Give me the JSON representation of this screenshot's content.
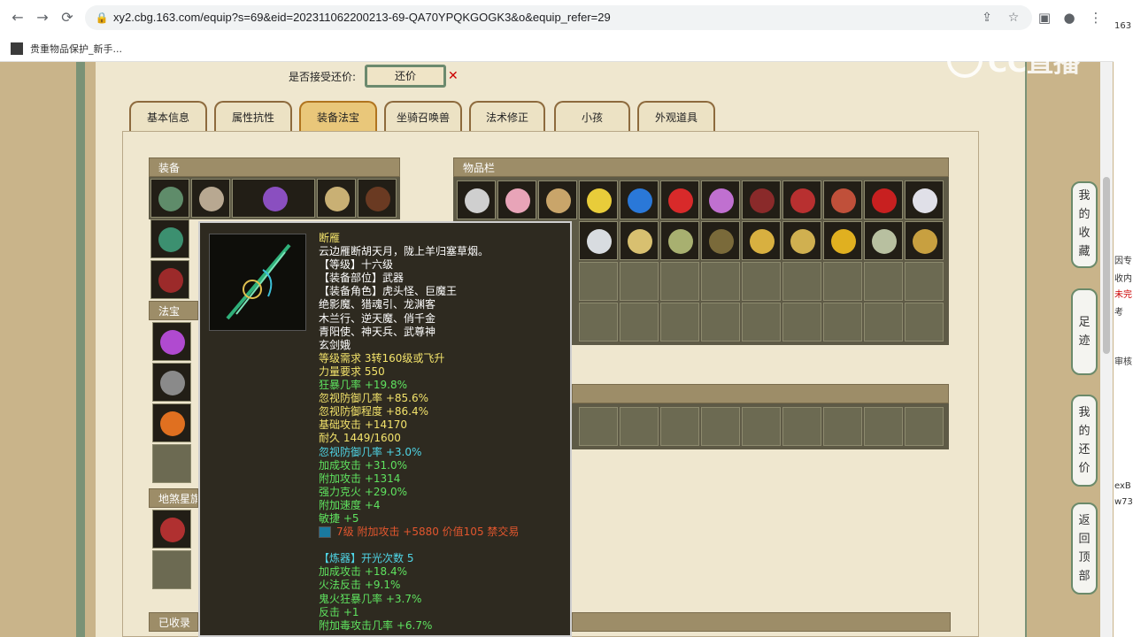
{
  "browser": {
    "url": "xy2.cbg.163.com/equip?s=69&eid=202311062200213-69-QA70YPQKGOGK3&o&equip_refer=29",
    "bookmark": "贵重物品保护_新手..."
  },
  "offer": {
    "label": "是否接受还价:",
    "button": "还价"
  },
  "tabs": [
    "基本信息",
    "属性抗性",
    "装备法宝",
    "坐骑召唤兽",
    "法术修正",
    "小孩",
    "外观道具"
  ],
  "active_tab": "装备法宝",
  "panels": {
    "equip": "装备",
    "items": "物品栏",
    "treasure": "法宝",
    "star": "地煞星旗",
    "collected": "已收录"
  },
  "tooltip": {
    "lines": [
      {
        "text": "断雁",
        "color": "#f3e36b"
      },
      {
        "text": "云边雁断胡天月，陇上羊归塞草烟。",
        "color": "#ffffff"
      },
      {
        "text": "【等级】十六级",
        "color": "#ffffff"
      },
      {
        "text": "【装备部位】武器",
        "color": "#ffffff"
      },
      {
        "text": "【装备角色】虎头怪、巨魔王",
        "color": "#ffffff"
      },
      {
        "text": "绝影魔、猎魂引、龙渊客",
        "color": "#ffffff"
      },
      {
        "text": "木兰行、逆天魔、俏千金",
        "color": "#ffffff"
      },
      {
        "text": "青阳使、神天兵、武尊神",
        "color": "#ffffff"
      },
      {
        "text": "玄剑娥",
        "color": "#ffffff"
      },
      {
        "text": "等级需求 3转160级或飞升",
        "color": "#f3e36b"
      },
      {
        "text": "力量要求 550",
        "color": "#f3e36b"
      },
      {
        "text": "狂暴几率 +19.8%",
        "color": "#5fe35f"
      },
      {
        "text": "忽视防御几率 +85.6%",
        "color": "#f3e36b"
      },
      {
        "text": "忽视防御程度 +86.4%",
        "color": "#f3e36b"
      },
      {
        "text": "基础攻击 +14170",
        "color": "#f3e36b"
      },
      {
        "text": "耐久 1449/1600",
        "color": "#f3e36b"
      },
      {
        "text": "忽视防御几率 +3.0%",
        "color": "#4fd5e6"
      },
      {
        "text": "加成攻击 +31.0%",
        "color": "#5fe35f"
      },
      {
        "text": "附加攻击 +1314",
        "color": "#5fe35f"
      },
      {
        "text": "强力克火 +29.0%",
        "color": "#5fe35f"
      },
      {
        "text": "附加速度 +4",
        "color": "#5fe35f"
      },
      {
        "text": "敏捷 +5",
        "color": "#5fe35f"
      },
      {
        "text": "7级 附加攻击 +5880 价值105 禁交易",
        "color": "#e2562e",
        "gem": true
      },
      {
        "text": "",
        "color": "#ffffff"
      },
      {
        "text": "【炼器】开光次数 5",
        "color": "#4fd5e6"
      },
      {
        "text": "加成攻击 +18.4%",
        "color": "#5fe35f"
      },
      {
        "text": "火法反击 +9.1%",
        "color": "#5fe35f"
      },
      {
        "text": "鬼火狂暴几率 +3.7%",
        "color": "#5fe35f"
      },
      {
        "text": "反击 +1",
        "color": "#5fe35f"
      },
      {
        "text": "附加毒攻击几率 +6.7%",
        "color": "#5fe35f"
      }
    ]
  },
  "side_buttons": [
    {
      "label": "我的收藏"
    },
    {
      "label": "足迹"
    },
    {
      "label": "我的还价"
    },
    {
      "label": "返回顶部"
    }
  ],
  "watermark": "CC直播",
  "right_strip": [
    "163",
    "因专",
    "收内",
    "未完",
    "考",
    "审核",
    "exB",
    "w73"
  ]
}
